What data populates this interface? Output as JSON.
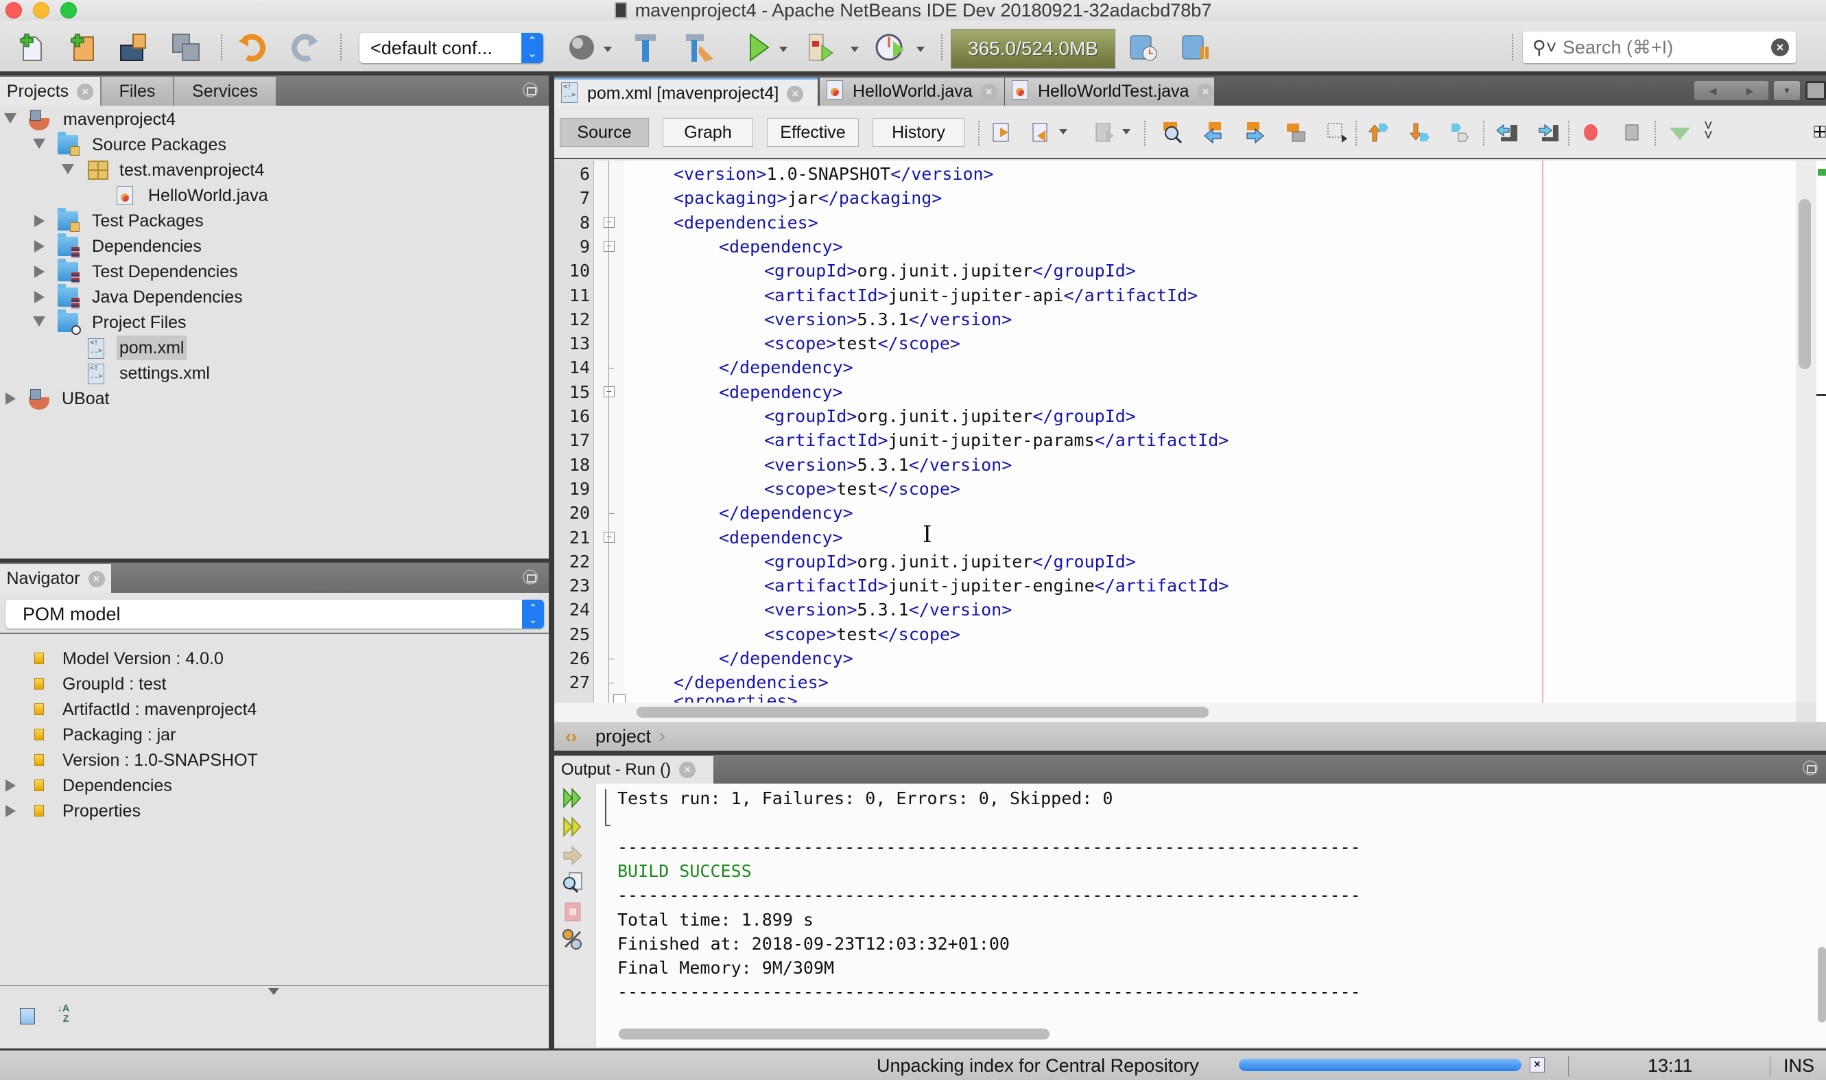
{
  "window": {
    "title": "mavenproject4 - Apache NetBeans IDE Dev 20180921-32adacbd78b7"
  },
  "toolbar": {
    "config_select_value": "<default conf...",
    "memory_meter": "365.0/524.0MB",
    "search_placeholder": "Search (⌘+I)",
    "icons": [
      "new-file-icon",
      "new-project-icon",
      "open-project-icon",
      "save-all-icon",
      "undo-icon",
      "redo-icon",
      "browser-icon",
      "build-icon",
      "clean-build-icon",
      "run-icon",
      "debug-icon",
      "profile-icon",
      "gc-icon",
      "pause-icon"
    ]
  },
  "projects_panel": {
    "tabs": [
      {
        "label": "Projects",
        "active": true
      },
      {
        "label": "Files",
        "active": false
      },
      {
        "label": "Services",
        "active": false
      }
    ],
    "tree": [
      {
        "label": "mavenproject4",
        "level": 0,
        "expanded": true,
        "icon": "maven-project-icon"
      },
      {
        "label": "Source Packages",
        "level": 1,
        "expanded": true,
        "icon": "source-folder-icon"
      },
      {
        "label": "test.mavenproject4",
        "level": 2,
        "expanded": true,
        "icon": "package-icon"
      },
      {
        "label": "HelloWorld.java",
        "level": 3,
        "icon": "java-file-icon"
      },
      {
        "label": "Test Packages",
        "level": 1,
        "expanded": false,
        "icon": "test-folder-icon"
      },
      {
        "label": "Dependencies",
        "level": 1,
        "expanded": false,
        "icon": "library-folder-icon"
      },
      {
        "label": "Test Dependencies",
        "level": 1,
        "expanded": false,
        "icon": "library-folder-icon"
      },
      {
        "label": "Java Dependencies",
        "level": 1,
        "expanded": false,
        "icon": "library-folder-icon"
      },
      {
        "label": "Project Files",
        "level": 1,
        "expanded": true,
        "icon": "project-files-folder-icon"
      },
      {
        "label": "pom.xml",
        "level": 2,
        "icon": "xml-file-icon",
        "selected": true
      },
      {
        "label": "settings.xml",
        "level": 2,
        "icon": "xml-file-icon"
      },
      {
        "label": "UBoat",
        "level": 0,
        "expanded": false,
        "icon": "maven-project-icon"
      }
    ]
  },
  "navigator_panel": {
    "tab_label": "Navigator",
    "view_select": "POM model",
    "items": [
      {
        "label": "Model Version : 4.0.0",
        "expandable": false
      },
      {
        "label": "GroupId : test",
        "expandable": false
      },
      {
        "label": "ArtifactId : mavenproject4",
        "expandable": false
      },
      {
        "label": "Packaging : jar",
        "expandable": false
      },
      {
        "label": "Version : 1.0-SNAPSHOT",
        "expandable": false
      },
      {
        "label": "Dependencies",
        "expandable": true
      },
      {
        "label": "Properties",
        "expandable": true
      }
    ]
  },
  "editor": {
    "tabs": [
      {
        "label": "pom.xml [mavenproject4]",
        "active": true,
        "icon": "xml-file-icon"
      },
      {
        "label": "HelloWorld.java",
        "active": false,
        "icon": "java-file-icon"
      },
      {
        "label": "HelloWorldTest.java",
        "active": false,
        "icon": "java-file-icon"
      }
    ],
    "view_buttons": [
      {
        "label": "Source",
        "active": true
      },
      {
        "label": "Graph",
        "active": false
      },
      {
        "label": "Effective",
        "active": false
      },
      {
        "label": "History",
        "active": false
      }
    ],
    "lines": [
      {
        "n": "6",
        "indent": 1,
        "open": "<version>",
        "text": "1.0-SNAPSHOT",
        "close": "</version>"
      },
      {
        "n": "7",
        "indent": 1,
        "open": "<packaging>",
        "text": "jar",
        "close": "</packaging>"
      },
      {
        "n": "8",
        "indent": 1,
        "open": "<dependencies>",
        "text": "",
        "close": "",
        "fold": "start"
      },
      {
        "n": "9",
        "indent": 2,
        "open": "<dependency>",
        "text": "",
        "close": "",
        "fold": "start"
      },
      {
        "n": "10",
        "indent": 3,
        "open": "<groupId>",
        "text": "org.junit.jupiter",
        "close": "</groupId>"
      },
      {
        "n": "11",
        "indent": 3,
        "open": "<artifactId>",
        "text": "junit-jupiter-api",
        "close": "</artifactId>"
      },
      {
        "n": "12",
        "indent": 3,
        "open": "<version>",
        "text": "5.3.1",
        "close": "</version>"
      },
      {
        "n": "13",
        "indent": 3,
        "open": "<scope>",
        "text": "test",
        "close": "</scope>"
      },
      {
        "n": "14",
        "indent": 2,
        "open": "</dependency>",
        "text": "",
        "close": "",
        "fold": "end"
      },
      {
        "n": "15",
        "indent": 2,
        "open": "<dependency>",
        "text": "",
        "close": "",
        "fold": "start"
      },
      {
        "n": "16",
        "indent": 3,
        "open": "<groupId>",
        "text": "org.junit.jupiter",
        "close": "</groupId>"
      },
      {
        "n": "17",
        "indent": 3,
        "open": "<artifactId>",
        "text": "junit-jupiter-params",
        "close": "</artifactId>"
      },
      {
        "n": "18",
        "indent": 3,
        "open": "<version>",
        "text": "5.3.1",
        "close": "</version>"
      },
      {
        "n": "19",
        "indent": 3,
        "open": "<scope>",
        "text": "test",
        "close": "</scope>"
      },
      {
        "n": "20",
        "indent": 2,
        "open": "</dependency>",
        "text": "",
        "close": "",
        "fold": "end"
      },
      {
        "n": "21",
        "indent": 2,
        "open": "<dependency>",
        "text": "",
        "close": "",
        "fold": "start"
      },
      {
        "n": "22",
        "indent": 3,
        "open": "<groupId>",
        "text": "org.junit.jupiter",
        "close": "</groupId>"
      },
      {
        "n": "23",
        "indent": 3,
        "open": "<artifactId>",
        "text": "junit-jupiter-engine",
        "close": "</artifactId>"
      },
      {
        "n": "24",
        "indent": 3,
        "open": "<version>",
        "text": "5.3.1",
        "close": "</version>"
      },
      {
        "n": "25",
        "indent": 3,
        "open": "<scope>",
        "text": "test",
        "close": "</scope>"
      },
      {
        "n": "26",
        "indent": 2,
        "open": "</dependency>",
        "text": "",
        "close": "",
        "fold": "end"
      },
      {
        "n": "27",
        "indent": 1,
        "open": "</dependencies>",
        "text": "",
        "close": "",
        "fold": "end"
      }
    ],
    "breadcrumb": "project"
  },
  "output": {
    "tab_label": "Output - Run ()",
    "lines": [
      {
        "text": "Tests run: 1, Failures: 0, Errors: 0, Skipped: 0",
        "style": "normal"
      },
      {
        "text": "",
        "style": "normal"
      },
      {
        "text": "------------------------------------------------------------------------",
        "style": "normal"
      },
      {
        "text": "BUILD SUCCESS",
        "style": "success"
      },
      {
        "text": "------------------------------------------------------------------------",
        "style": "normal"
      },
      {
        "text": "Total time: 1.899 s",
        "style": "normal"
      },
      {
        "text": "Finished at: 2018-09-23T12:03:32+01:00",
        "style": "normal"
      },
      {
        "text": "Final Memory: 9M/309M",
        "style": "normal"
      },
      {
        "text": "------------------------------------------------------------------------",
        "style": "normal"
      }
    ],
    "side_icons": [
      "rerun-icon",
      "rerun-with-options-icon",
      "step-icon",
      "inspect-icon",
      "stop-icon",
      "settings-icon"
    ]
  },
  "statusbar": {
    "message": "Unpacking index for Central Repository",
    "progress_percent": 100,
    "cursor_position": "13:11",
    "insert_mode": "INS"
  },
  "colors": {
    "xml_tag": "#1515b0",
    "build_success": "#1b8a1b",
    "accent_blue": "#1f7cf2"
  }
}
